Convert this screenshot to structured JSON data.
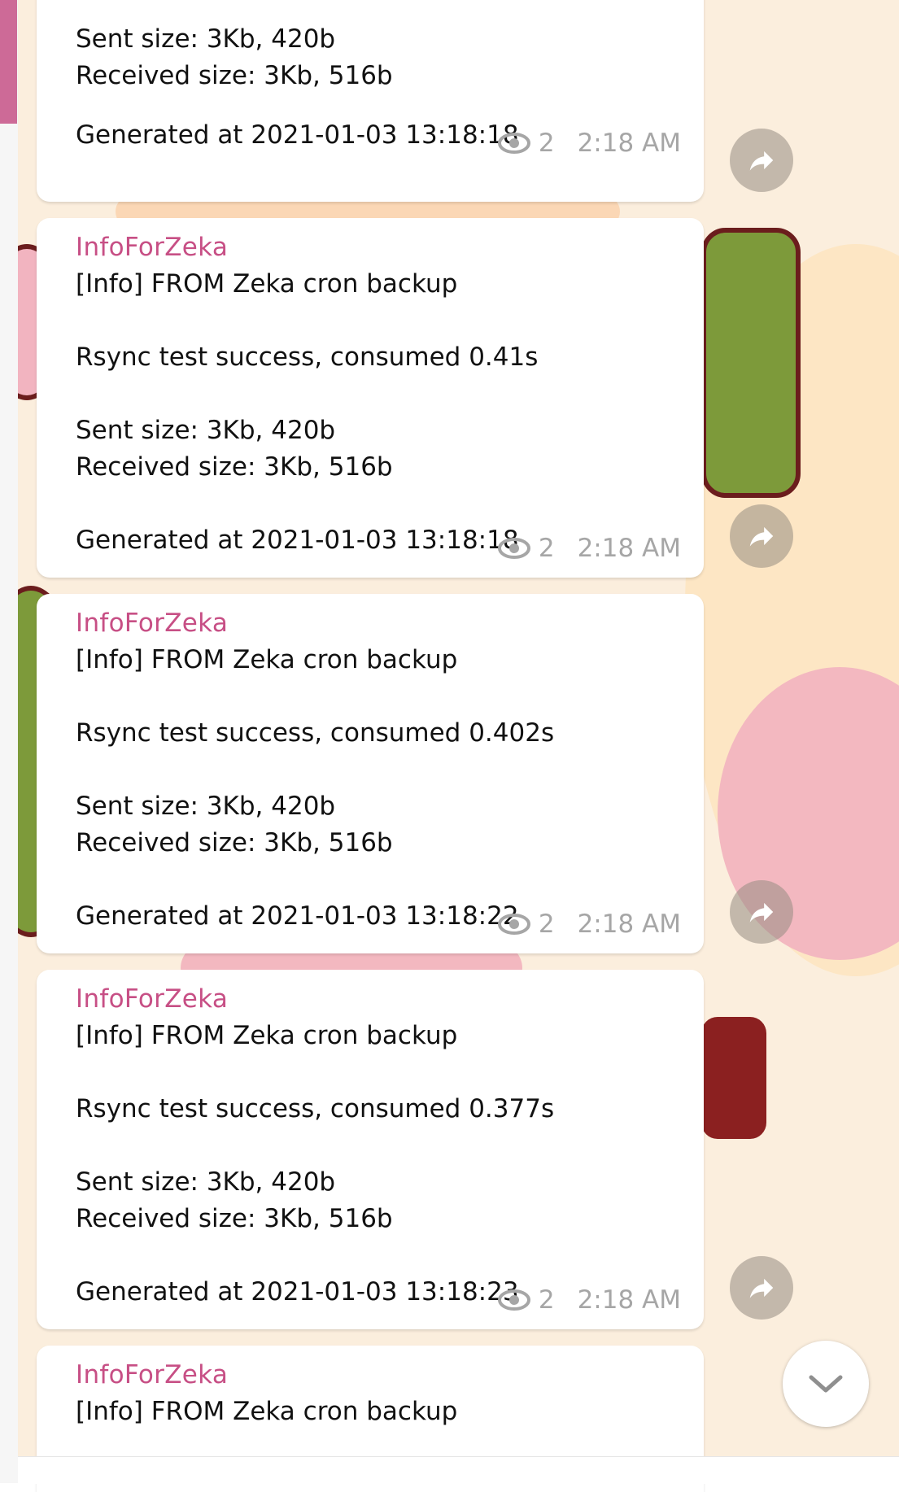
{
  "colors": {
    "accent": "#cd6a97",
    "sender": "#c74f85",
    "meta": "#a6a6a6",
    "background": "#fbeedd"
  },
  "messages": [
    {
      "sender": "",
      "lines": [
        "Sent size: 3Kb, 420b",
        "Received size: 3Kb, 516b",
        "",
        "Generated at 2021-01-03 13:18:18"
      ],
      "views": "2",
      "time": "2:18 AM"
    },
    {
      "sender": "InfoForZeka",
      "lines": [
        "[Info] FROM Zeka cron backup",
        "",
        "Rsync test success, consumed 0.41s",
        "",
        "Sent size: 3Kb, 420b",
        "Received size: 3Kb, 516b",
        "",
        "Generated at 2021-01-03 13:18:18"
      ],
      "views": "2",
      "time": "2:18 AM"
    },
    {
      "sender": "InfoForZeka",
      "lines": [
        "[Info] FROM Zeka cron backup",
        "",
        "Rsync test success, consumed 0.402s",
        "",
        "Sent size: 3Kb, 420b",
        "Received size: 3Kb, 516b",
        "",
        "Generated at 2021-01-03 13:18:22"
      ],
      "views": "2",
      "time": "2:18 AM"
    },
    {
      "sender": "InfoForZeka",
      "lines": [
        "[Info] FROM Zeka cron backup",
        "",
        "Rsync test success, consumed 0.377s",
        "",
        "Sent size: 3Kb, 420b",
        "Received size: 3Kb, 516b",
        "",
        "Generated at 2021-01-03 13:18:23"
      ],
      "views": "2",
      "time": "2:18 AM"
    },
    {
      "sender": "InfoForZeka",
      "lines": [
        "[Info] FROM Zeka cron backup"
      ],
      "views": "",
      "time": ""
    }
  ],
  "icons": {
    "views": "eye-icon",
    "share": "share-arrow-icon",
    "scroll": "chevron-down-icon"
  }
}
